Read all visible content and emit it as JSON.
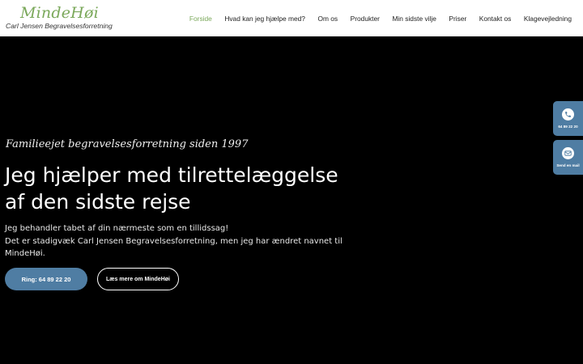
{
  "header": {
    "logo_title": "MindeHøi",
    "logo_subtitle": "Carl Jensen Begravelsesforretning",
    "nav": [
      {
        "label": "Forside",
        "active": true
      },
      {
        "label": "Hvad kan jeg hjælpe med?",
        "active": false
      },
      {
        "label": "Om os",
        "active": false
      },
      {
        "label": "Produkter",
        "active": false
      },
      {
        "label": "Min sidste vilje",
        "active": false
      },
      {
        "label": "Priser",
        "active": false
      },
      {
        "label": "Kontakt os",
        "active": false
      },
      {
        "label": "Klagevejledning",
        "active": false
      }
    ]
  },
  "hero": {
    "tagline": "Familieejet begravelsesforretning siden 1997",
    "headline": "Jeg hjælper med tilrettelæggelse af den sidste rejse",
    "body_line1": "Jeg behandler tabet af din nærmeste som en tillidssag!",
    "body_line2": "Det er stadigvæk Carl Jensen Begravelsesforretning, men jeg har ændret navnet til MindeHøi.",
    "primary_button": "Ring: 64 89 22 20",
    "secondary_button": "Læs mere om MindeHøi"
  },
  "side_tabs": {
    "phone_label": "64 89 22 20",
    "phone_icon": "phone-icon",
    "mail_label": "Send en mail",
    "mail_icon": "mail-icon"
  },
  "colors": {
    "accent_green": "#7aa85a",
    "button_blue": "#4f7da3",
    "hero_background": "#000000"
  }
}
